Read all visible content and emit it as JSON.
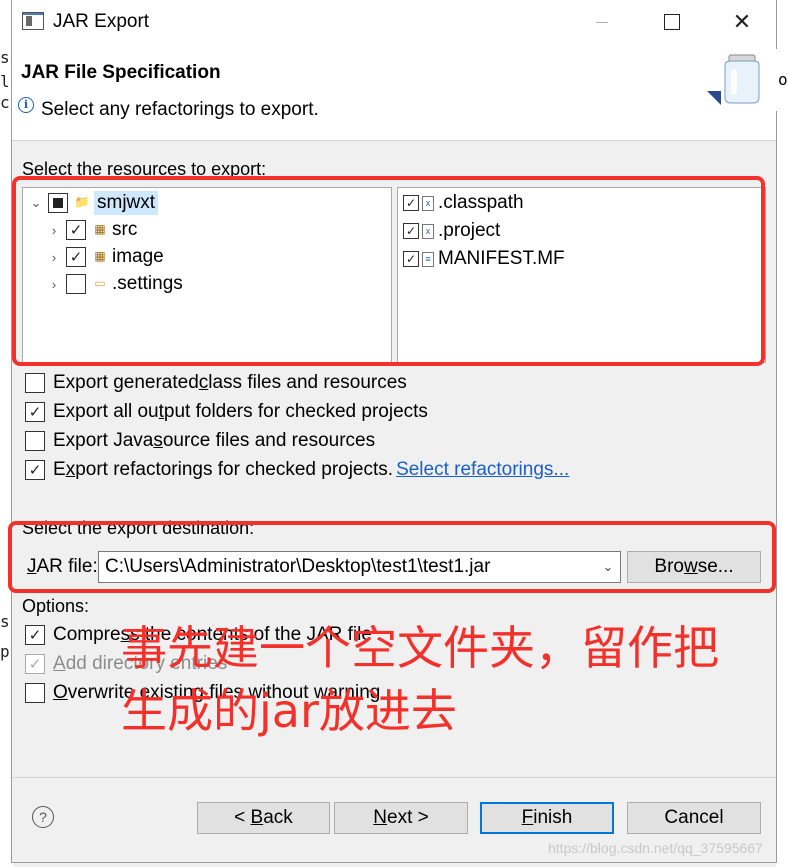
{
  "window": {
    "title": "JAR Export"
  },
  "header": {
    "title": "JAR File Specification",
    "message": "Select any refactorings to export."
  },
  "background_fragments": {
    "left": [
      "s:",
      "li",
      "c("
    ],
    "left_lower": [
      "sk",
      "p"
    ],
    "right": "o"
  },
  "resources": {
    "label": "Select the resources to export:",
    "tree": [
      {
        "name": "smjwxt",
        "checked": "partial",
        "expanded": true
      },
      {
        "name": "src",
        "checked": true
      },
      {
        "name": "image",
        "checked": true
      },
      {
        "name": ".settings",
        "checked": false
      }
    ],
    "files": [
      {
        "name": ".classpath",
        "checked": true
      },
      {
        "name": ".project",
        "checked": true
      },
      {
        "name": "MANIFEST.MF",
        "checked": true
      }
    ]
  },
  "export_options": {
    "class_files": {
      "pre": "Export generated ",
      "mnemonic": "c",
      "post": "lass files and resources",
      "checked": false
    },
    "output_folders": {
      "pre": "Export all ou",
      "mnemonic": "t",
      "post": "put folders for checked projects",
      "checked": true
    },
    "java_source": {
      "pre": "Export Java ",
      "mnemonic": "s",
      "post": "ource files and resources",
      "checked": false
    },
    "refactorings": {
      "pre": "E",
      "mnemonic": "x",
      "post": "port refactorings for checked projects.",
      "checked": true
    },
    "select_refactorings_link": "Select refactorings..."
  },
  "destination": {
    "label": "Select the export destination:",
    "jar_label_mnemonic": "J",
    "jar_label_rest": "AR file:",
    "jar_path": "C:\\Users\\Administrator\\Desktop\\test1\\test1.jar",
    "browse_mnemonic": "w",
    "browse_pre": "Bro",
    "browse_post": "se..."
  },
  "options": {
    "label": "Options:",
    "compress": {
      "pre": "Compre",
      "mnemonic": "s",
      "post": "s the contents of the JAR file",
      "checked": true
    },
    "directory_entries": {
      "pre": "",
      "mnemonic": "A",
      "post": "dd directory entries",
      "checked": true,
      "disabled": true
    },
    "overwrite": {
      "pre": "",
      "mnemonic": "O",
      "post": "verwrite existing files without warning",
      "checked": false
    }
  },
  "annotation": {
    "line1": "事先建一个空文件夹，留作把",
    "line2": "生成的jar放进去",
    "color": "#f4302a"
  },
  "buttons": {
    "back_pre": "< ",
    "back_mnemonic": "B",
    "back_post": "ack",
    "next_mnemonic": "N",
    "next_post": "ext >",
    "finish_mnemonic": "F",
    "finish_post": "inish",
    "cancel": "Cancel"
  },
  "watermark": "https://blog.csdn.net/qq_37595667",
  "colors": {
    "accent": "#0078d7",
    "link": "#1a5fc8",
    "annotation": "#f4302a"
  }
}
